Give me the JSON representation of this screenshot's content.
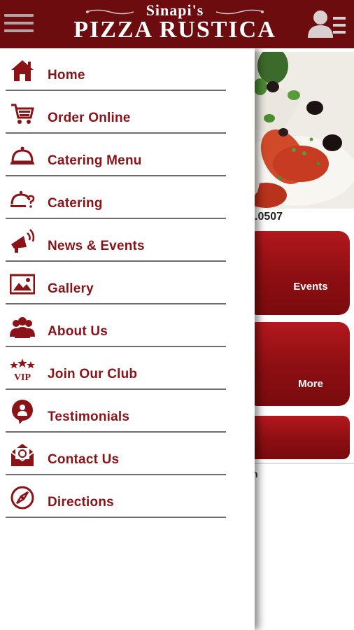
{
  "header": {
    "brand_top": "Sinapi's",
    "brand_bottom": "PIZZA RUSTICA",
    "menu_icon": "hamburger-menu-icon",
    "user_icon": "user-list-icon"
  },
  "colors": {
    "header_bg": "#6d0c0e",
    "menu_text": "#8b1216",
    "tile_red": "#a21418",
    "divider": "#6e6e6e"
  },
  "drawer": {
    "items": [
      {
        "label": "Home",
        "icon": "home-icon"
      },
      {
        "label": "Order Online",
        "icon": "shopping-cart-icon"
      },
      {
        "label": "Catering Menu",
        "icon": "serving-tray-icon"
      },
      {
        "label": "Catering",
        "icon": "catering-question-icon"
      },
      {
        "label": "News & Events",
        "icon": "megaphone-icon"
      },
      {
        "label": "Gallery",
        "icon": "picture-icon"
      },
      {
        "label": "About Us",
        "icon": "people-icon"
      },
      {
        "label": "Join Our Club",
        "icon": "vip-stars-icon"
      },
      {
        "label": "Testimonials",
        "icon": "testimonial-bubble-icon"
      },
      {
        "label": "Contact Us",
        "icon": "envelope-icon"
      },
      {
        "label": "Directions",
        "icon": "compass-icon"
      }
    ]
  },
  "background": {
    "phone_fragment": ".0507",
    "tiles": [
      {
        "label": "Events",
        "icon": "megaphone-icon"
      },
      {
        "label": "More",
        "icon": "grid-icon"
      }
    ],
    "stray_text": "n"
  }
}
